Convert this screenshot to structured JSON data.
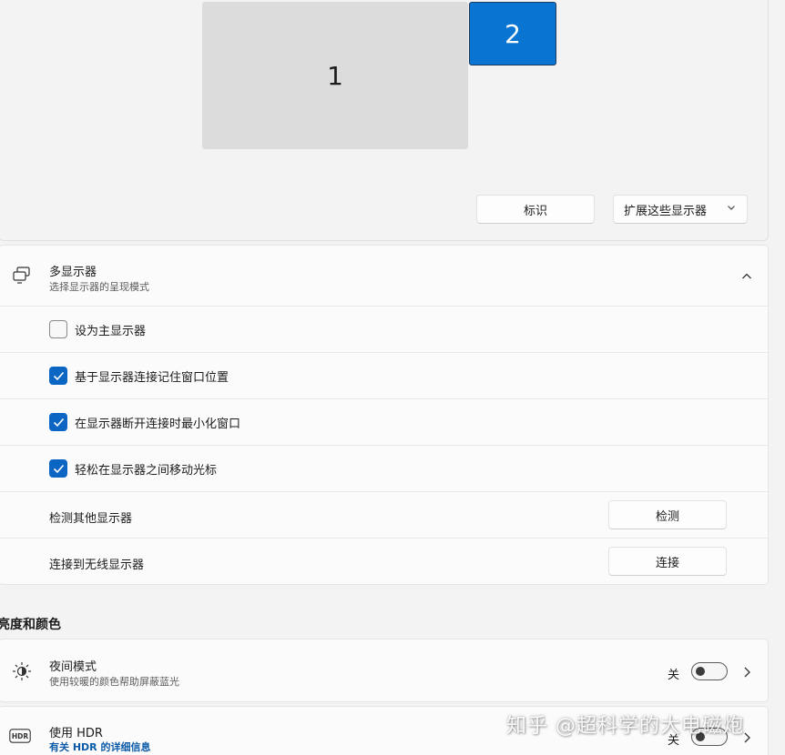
{
  "arrangement": {
    "monitor_1_label": "1",
    "monitor_2_label": "2",
    "identify_label": "标识",
    "extend_label": "扩展这些显示器"
  },
  "multi_display": {
    "title": "多显示器",
    "subtitle": "选择显示器的呈现模式",
    "options": [
      {
        "label": "设为主显示器",
        "checked": false
      },
      {
        "label": "基于显示器连接记住窗口位置",
        "checked": true
      },
      {
        "label": "在显示器断开连接时最小化窗口",
        "checked": true
      },
      {
        "label": "轻松在显示器之间移动光标",
        "checked": true
      }
    ],
    "detect_label": "检测其他显示器",
    "detect_button": "检测",
    "wireless_label": "连接到无线显示器",
    "connect_button": "连接"
  },
  "brightness_section": {
    "heading": "亮度和颜色"
  },
  "night_light": {
    "title": "夜间模式",
    "subtitle": "使用较暖的颜色帮助屏蔽蓝光",
    "state": "关"
  },
  "hdr": {
    "title": "使用 HDR",
    "link": "有关 HDR 的详细信息",
    "state": "关",
    "icon_text": "HDR"
  },
  "watermark": "知乎 @超科学的大电磁炮",
  "colors": {
    "accent": "#0a66c2",
    "monitor_selected": "#0a74d2",
    "monitor_idle": "#dcdcdc",
    "background": "#f3f3f3",
    "card": "#fbfbfb"
  }
}
